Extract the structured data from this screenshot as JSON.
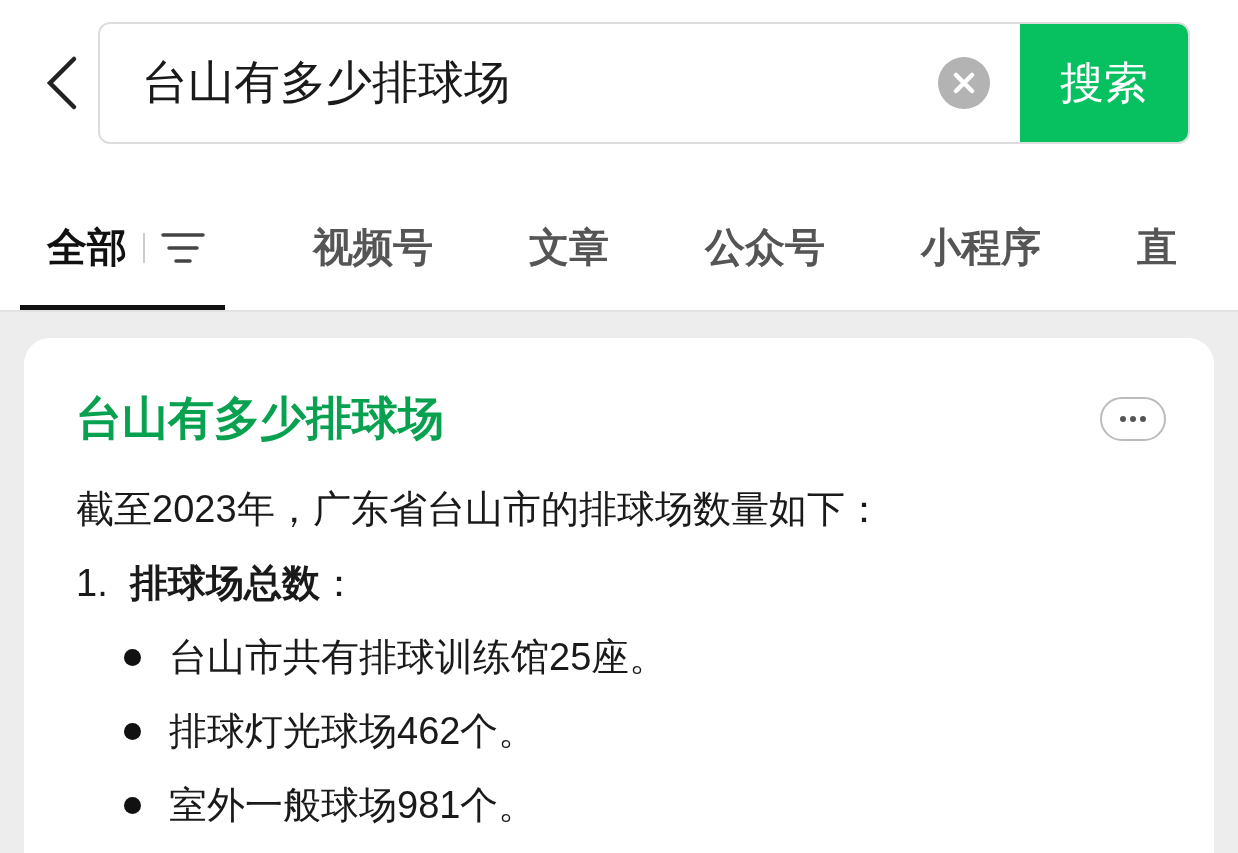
{
  "search": {
    "value": "台山有多少排球场",
    "button": "搜索"
  },
  "tabs": [
    {
      "label": "全部",
      "selected": true,
      "kind": "filter"
    },
    {
      "label": "视频号",
      "selected": false,
      "kind": "plain"
    },
    {
      "label": "文章",
      "selected": false,
      "kind": "plain"
    },
    {
      "label": "公众号",
      "selected": false,
      "kind": "plain"
    },
    {
      "label": "小程序",
      "selected": false,
      "kind": "plain"
    },
    {
      "label": "直",
      "selected": false,
      "kind": "plain"
    }
  ],
  "result": {
    "title": "台山有多少排球场",
    "intro": "截至2023年，广东省台山市的排球场数量如下：",
    "sections": [
      {
        "number": "1.",
        "heading": "**排球场总数**：",
        "bullets": [
          "台山市共有排球训练馆25座。",
          "排球灯光球场462个。",
          "室外一般球场981个。"
        ]
      }
    ]
  }
}
